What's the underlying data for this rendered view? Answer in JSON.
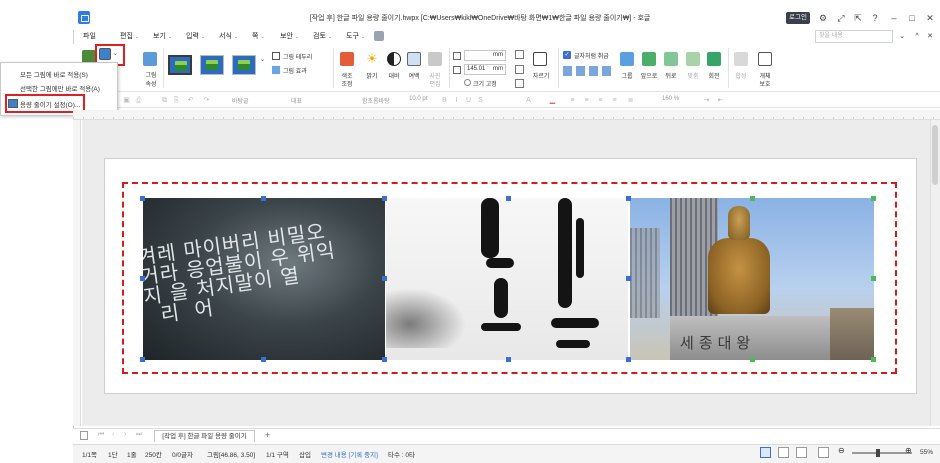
{
  "window": {
    "title": "[작업 후] 한글 파일 용량 줄이기.hwpx [C:₩Users₩kikl₩OneDrive₩바탕 화면₩1₩한글 파일 용량 줄이기₩] - 호글",
    "login_label": "로그인",
    "icons": [
      "settings-icon",
      "expand-icon",
      "pin-icon",
      "help-icon"
    ],
    "controls": [
      "minimize-icon",
      "maximize-icon",
      "close-icon"
    ]
  },
  "menu": {
    "items": [
      {
        "label": "파일",
        "caret": ""
      },
      {
        "label": "편집",
        "caret": "⌄"
      },
      {
        "label": "보기",
        "caret": "⌄"
      },
      {
        "label": "입력",
        "caret": "⌄"
      },
      {
        "label": "서식",
        "caret": "⌄"
      },
      {
        "label": "쪽",
        "caret": "⌄"
      },
      {
        "label": "보안",
        "caret": "⌄"
      },
      {
        "label": "검토",
        "caret": "⌄"
      },
      {
        "label": "도구",
        "caret": "⌄"
      }
    ],
    "search_placeholder": "찾을 내용"
  },
  "ribbon": {
    "picture_props_label": "그림",
    "picture_props_label2": "속성",
    "border_label": "그림 테두리",
    "effect_label": "그림 효과",
    "color_adjust_label": "색조",
    "color_adjust_label2": "조정",
    "brightness_label": "밝기",
    "contrast_label": "대비",
    "margin_label": "여백",
    "picture_edit_label": "사진",
    "picture_edit_label2": "편집",
    "width_value": "",
    "width_unit": "mm",
    "height_value": "145.01",
    "height_unit": "mm",
    "fix_size_label": "크기 고정",
    "crop_label": "자르기",
    "wrap_text_label": "글자처럼 취급",
    "group_label": "그룹",
    "front_label": "앞으로",
    "back_label": "뒤로",
    "align_label": "맞춤",
    "rotate_label": "회전",
    "merge_label": "합성",
    "object_label": "개체",
    "object_label2": "보호"
  },
  "dropdown": {
    "items": [
      "모든 그림에 바로 적용(S)",
      "선택한 그림에만 바로 적용(A)",
      "용량 줄이기 설정(O)..."
    ]
  },
  "formatbar": {
    "style_value": "바탕글",
    "lang_value": "대표",
    "font_value": "함초롬바탕",
    "size_value": "10.0",
    "size_unit": "pt",
    "spacing_value": "160",
    "spacing_unit": "%"
  },
  "document": {
    "img1_lines": [
      "겨레 마이버리 비밀오",
      "거라 응업불이 우 위익",
      "지 을 처지말이 열",
      "  리  어"
    ],
    "statue_caption": "세종대왕"
  },
  "tabs": {
    "doc_tab": "[작업 후] 한글 파일 용량 줄이기",
    "add_label": "+"
  },
  "status": {
    "page": "1/1쪽",
    "section": "1단",
    "line": "1줄",
    "col": "250칸",
    "chars": "0/0글자",
    "picture_info": "그림[46.86, 3.50]",
    "area": "1/1 구역",
    "insert": "삽입",
    "track": "변경 내용 [기록 중지]",
    "extra": "타수 : 0타",
    "zoom": "55%"
  },
  "colors": {
    "highlight": "#e02020",
    "selection_handle": "#3b6fd6",
    "login_bg": "#3a3f4b"
  }
}
